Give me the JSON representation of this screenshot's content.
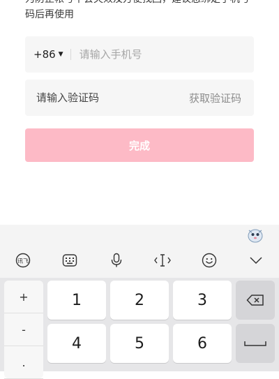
{
  "notice": {
    "text": "为防止帐号不会失效及方便找回，建议您绑定手机号码后再使用"
  },
  "phone": {
    "country_code": "+86",
    "placeholder": "请输入手机号"
  },
  "code": {
    "placeholder": "请输入验证码",
    "get_code_label": "获取验证码"
  },
  "done_button": {
    "label": "完成",
    "color": "#fdbac6"
  },
  "keyboard": {
    "toolbar_icons": [
      "voice-input-icon",
      "keyboard-icon",
      "microphone-icon",
      "cursor-icon",
      "emoji-icon",
      "collapse-icon"
    ],
    "symbols": [
      "+",
      "-",
      "."
    ],
    "keys": [
      [
        "1",
        "2",
        "3"
      ],
      [
        "4",
        "5",
        "6"
      ]
    ],
    "backspace_icon": "backspace-icon",
    "space_icon": "space-icon"
  }
}
